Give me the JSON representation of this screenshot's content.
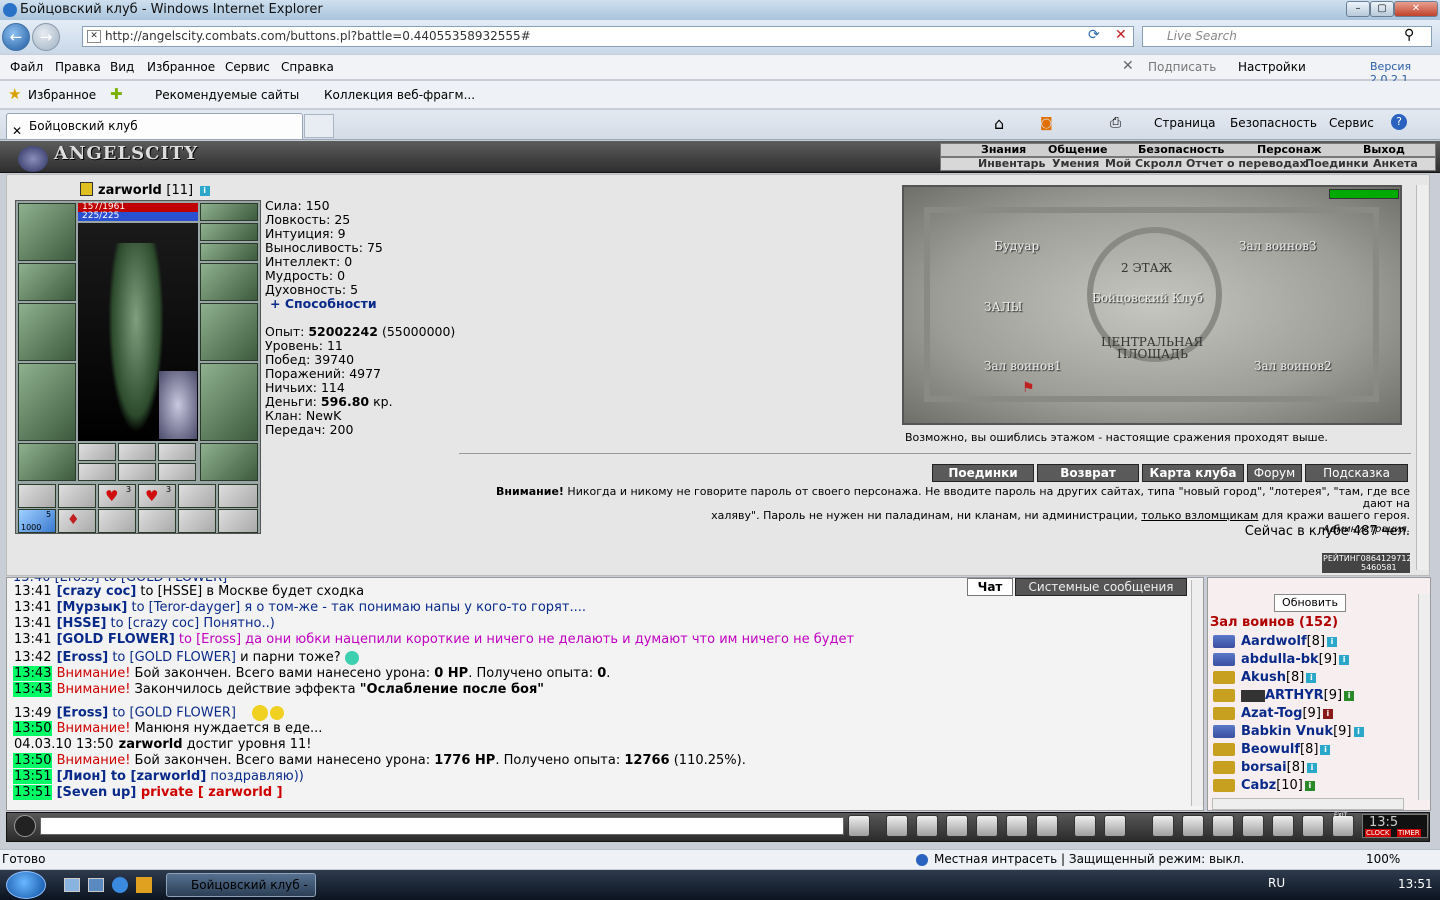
{
  "window": {
    "title": "Бойцовский клуб - Windows Internet Explorer"
  },
  "browser": {
    "url": "http://angelscity.combats.com/buttons.pl?battle=0.44055358932555#",
    "search_placeholder": "Live Search",
    "menu": [
      "Файл",
      "Правка",
      "Вид",
      "Избранное",
      "Сервис",
      "Справка"
    ],
    "toolbar_right": {
      "subscribe": "Подписать",
      "settings": "Настройки",
      "version": "Версия 2.0.2.1"
    },
    "favorites": {
      "label": "Избранное",
      "recommended": "Рекомендуемые сайты",
      "collection": "Коллекция веб-фрагм..."
    },
    "tab_title": "Бойцовский клуб",
    "cmd": {
      "page": "Страница",
      "security": "Безопасность",
      "service": "Сервис"
    }
  },
  "game": {
    "logo": "ANGELSCITY",
    "tabs": [
      "Знания",
      "Общение",
      "Безопасность",
      "Персонаж",
      "Выход"
    ],
    "subtabs": [
      "Инвентарь",
      "Умения",
      "Мой Скролл",
      "Отчет о переводах",
      "Поединки",
      "Анкета"
    ],
    "character": {
      "name": "zarworld",
      "level": "[11]",
      "hp": "157/1961",
      "mana": "225/225"
    },
    "inventory_counts": {
      "slot1": "3",
      "slot2": "3",
      "slot3": "5",
      "slot3_sub": "1000"
    },
    "stats": [
      {
        "label": "Сила: ",
        "value": "150"
      },
      {
        "label": "Ловкость: ",
        "value": "25"
      },
      {
        "label": "Интуиция: ",
        "value": "9"
      },
      {
        "label": "Выносливость: ",
        "value": "75"
      },
      {
        "label": "Интеллект: ",
        "value": "0"
      },
      {
        "label": "Мудрость: ",
        "value": "0"
      },
      {
        "label": "Духовность: ",
        "value": "5"
      }
    ],
    "abilities_link": "+ Способности",
    "experience": {
      "label": "Опыт: ",
      "value": "52002242",
      "next": "(55000000)"
    },
    "info": [
      {
        "label": "Уровень: ",
        "value": "11"
      },
      {
        "label": "Побед: ",
        "value": "39740"
      },
      {
        "label": "Поражений: ",
        "value": "4977"
      },
      {
        "label": "Ничьих: ",
        "value": "114"
      }
    ],
    "money": {
      "label": "Деньги: ",
      "value": "596.80",
      "unit": " кр."
    },
    "clan": {
      "label": "Клан: ",
      "value": "NewK"
    },
    "transfers": {
      "label": "Передач: ",
      "value": "200"
    },
    "map": {
      "rooms": [
        "Будуар",
        "Зал воинов3",
        "2 ЭТАЖ",
        "Бойцовский Клуб",
        "ЗАЛЫ",
        "ЦЕНТРАЛЬНАЯ",
        "ПЛОЩАДЬ",
        "Зал воинов1",
        "Зал воинов2"
      ],
      "hint": "Возможно, вы ошиблись этажом - настоящие сражения проходят выше."
    },
    "buttons": [
      "Поединки",
      "Возврат",
      "Карта клуба",
      "Форум",
      "Подсказка"
    ],
    "warning": {
      "title": "Внимание!",
      "line1": " Никогда и никому не говорите пароль от своего персонажа. Не вводите пароль на других сайтах, типа \"новый город\", \"лотерея\", \"там, где все дают на",
      "line2a": "халяву\". Пароль не нужен ни паладинам, ни кланам, ни администрации, ",
      "line2link": "только взломщикам",
      "line2b": " для кражи вашего героя.",
      "signature": "Администрация."
    },
    "online": "Сейчас в клубе 487 чел.",
    "rating": {
      "label": "РЕЙТИНГ",
      "value1": "0864129712",
      "value2": "5460581"
    }
  },
  "chat": {
    "tabs": [
      "Чат",
      "Системные сообщения"
    ],
    "messages": [
      {
        "time": "13:41",
        "nick": "[crazy coc]",
        "to": " to [HSSE]",
        "text": " в Москве будет сходка"
      },
      {
        "time": "13:41",
        "nick": "[Мурзык]",
        "to": " to [Teror-dayger]",
        "text": " я о том-же - так понимаю напы у кого-то горят...."
      },
      {
        "time": "13:41",
        "nick": "[HSSE]",
        "to": " to [crazy coc]",
        "text": " Понятно..)"
      },
      {
        "time": "13:41",
        "nick": "[GOLD FLOWER]",
        "to": " to [Eross]",
        "text": " да они юбки нацепили короткие и ничего не делають и думают что им ничего не будет"
      },
      {
        "time": "13:42",
        "nick": "[Eross]",
        "to": " to [GOLD FLOWER]",
        "text": " и парни тоже?"
      },
      {
        "time": "13:43",
        "warn": "Внимание!",
        "text": " Бой закончен. Всего вами нанесено урона: ",
        "b1": "0 HP",
        "text2": ". Получено опыта: ",
        "b2": "0",
        "text3": "."
      },
      {
        "time": "13:43",
        "warn": "Внимание!",
        "text": " Закончилось действие эффекта ",
        "b1": "\"Ослабление после боя\""
      },
      {
        "time": "13:49",
        "nick": "[Eross]",
        "to": " to [GOLD FLOWER]",
        "text": ""
      },
      {
        "time": "13:50",
        "warn": "Внимание!",
        "text": " Манюня нуждается в еде..."
      },
      {
        "time": "04.03.10 13:50",
        "nick": "zarworld",
        "text": " достиг уровня 11!"
      },
      {
        "time": "13:50",
        "warn": "Внимание!",
        "text": " Бой закончен. Всего вами нанесено урона: ",
        "b1": "1776 HP",
        "text2": ". Получено опыта: ",
        "b2": "12766",
        "text3": " (110.25%)."
      },
      {
        "time": "13:51",
        "nick": "[Лион]",
        "to": " to [zarworld]",
        "text": " поздравляю))"
      },
      {
        "time": "13:51",
        "nick": "[Seven up]",
        "private": " private [ zarworld ]"
      }
    ],
    "top_partial": "13:40 [Eross] to [GOLD FLOWER]"
  },
  "sidebar": {
    "refresh": "Обновить",
    "room": "Зал воинов (152)",
    "users": [
      {
        "name": "Aardwolf",
        "lvl": "[8]"
      },
      {
        "name": "abdulla-bk",
        "lvl": "[9]"
      },
      {
        "name": "Akush",
        "lvl": "[8]"
      },
      {
        "name": "ARTHYR",
        "lvl": "[9]"
      },
      {
        "name": "Azat-Tog",
        "lvl": "[9]"
      },
      {
        "name": "Babkin Vnuk",
        "lvl": "[9]"
      },
      {
        "name": "Beowulf",
        "lvl": "[8]"
      },
      {
        "name": "borsai",
        "lvl": "[8]"
      },
      {
        "name": "Cabz",
        "lvl": "[10]"
      }
    ]
  },
  "clock": {
    "time": "13:5",
    "label1": "CLOCK",
    "label2": "TIMER",
    "exit": "EXIT"
  },
  "statusbar": {
    "ready": "Готово",
    "zone": "Местная интрасеть | Защищенный режим: выкл.",
    "zoom": "100%"
  },
  "taskbar": {
    "task": "Бойцовский клуб - ...",
    "lang": "RU",
    "time": "13:51"
  }
}
